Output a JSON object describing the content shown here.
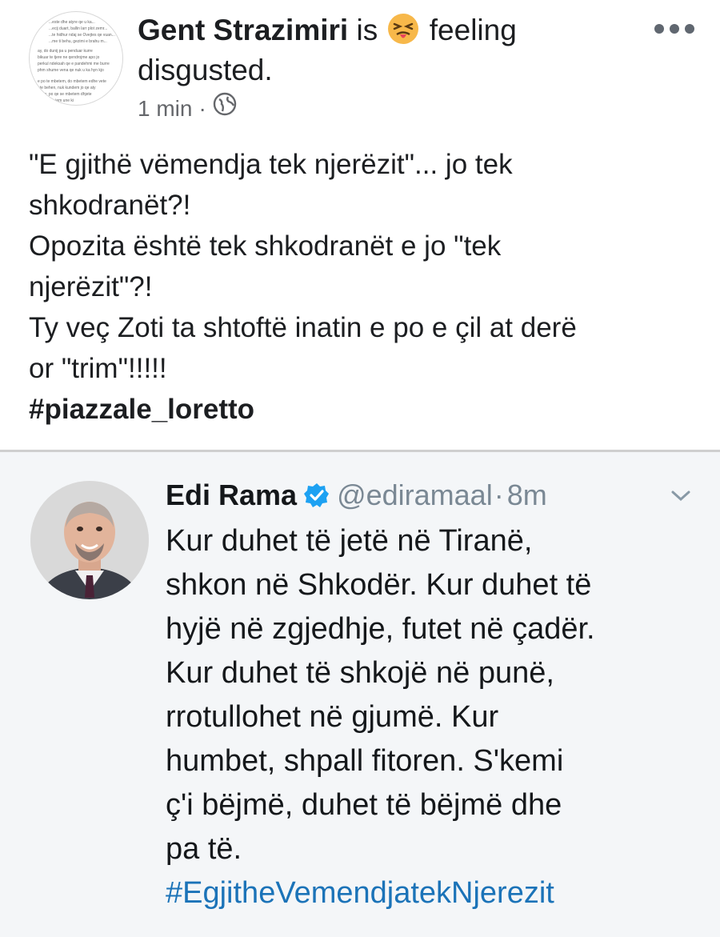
{
  "post": {
    "author": "Gent Strazimiri",
    "is_word": "is",
    "feeling_prefix": "feeling",
    "feeling": "disgusted.",
    "time": "1 min",
    "separator": "·",
    "globe_icon": "globe-icon",
    "more_icon": "more-options-icon",
    "avatar_lines": [
      "...este dhe atyre qe u ka...",
      "...ecij duart, ballin larr plot zemr...",
      "...te hidhur ndaj se Ovejtes qe vuan...",
      "...me ti behu, gezimi e brahu m...",
      "ay, do dunij pa u penduar kurre",
      "bikuar te tjere ne qendrojme apo jo",
      "perkul ndeksah qe e pandehmi me burre",
      "phm shume vena qe nuk u ka hyn kjo",
      "e po te mbetem, do mbetem edhe vete",
      "t te behen, nuk kundem jo qe aty",
      "...em, po qe se mbetem dhjete",
      "...thje- do jem une ki"
    ],
    "body_lines": [
      "\"E gjithë vëmendja tek njerëzit\"... jo tek",
      "shkodranët?!",
      "Opozita është tek shkodranët e jo \"tek",
      "njerëzit\"?!",
      "Ty veç Zoti ta shtoftë inatin e po e çil at derë",
      "or \"trim\"!!!!!"
    ],
    "hashtag": "#piazzale_loretto"
  },
  "tweet": {
    "name": "Edi Rama",
    "verified_icon": "verified-badge-icon",
    "handle": "@ediramaal",
    "separator": "·",
    "time": "8m",
    "chevron_icon": "chevron-down-icon",
    "text_lines": [
      "Kur duhet të jetë në Tiranë,",
      "shkon në Shkodër. Kur duhet të",
      "hyjë në zgjedhje, futet në çadër.",
      "Kur duhet të shkojë në punë,",
      "rrotullohet në gjumë. Kur",
      "humbet, shpall fitoren. S'kemi",
      "ç'i bëjmë, duhet të bëjmë dhe",
      "pa të."
    ],
    "hashtag": "#EgjitheVemendjatekNjerezit"
  },
  "colors": {
    "meta_gray": "#65676b",
    "tweet_bg": "#f4f6f8",
    "hashtag_blue": "#1b73b8",
    "verified_blue": "#1da1f2"
  }
}
